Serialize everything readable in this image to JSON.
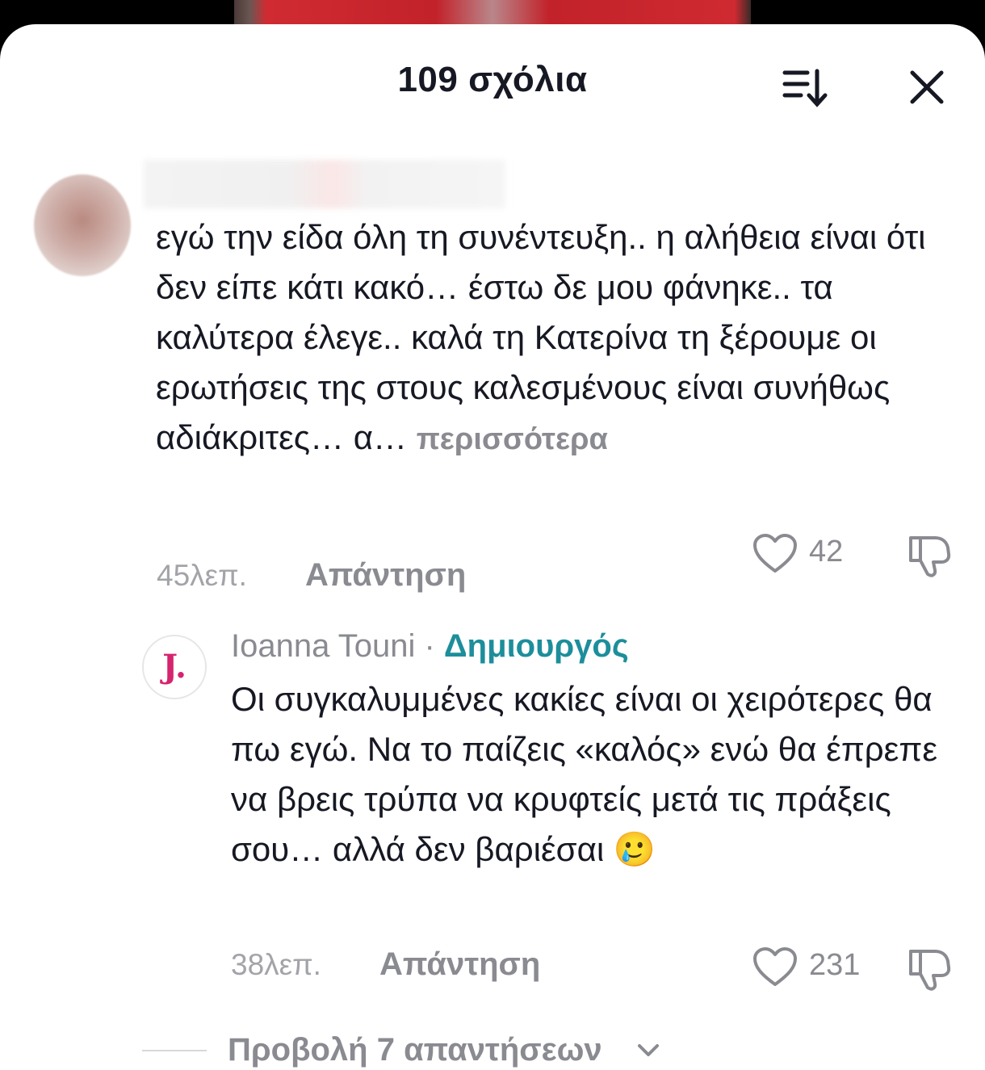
{
  "header": {
    "title": "109 σχόλια",
    "sort_icon": "sort-descending-icon",
    "close_icon": "close-icon"
  },
  "comments": [
    {
      "text": "εγώ την είδα όλη τη συνέντευξη.. η αλήθεια είναι ότι δεν είπε κάτι κακό… έστω δε μου φάνηκε.. τα καλύτερα έλεγε.. καλά τη Κατερίνα τη ξέρουμε οι ερωτήσεις της στους καλεσμένους είναι συνήθως αδιάκριτες… α…",
      "more_label": "περισσότερα",
      "time": "45λεπ.",
      "reply_label": "Απάντηση",
      "likes": "42"
    },
    {
      "author": "Ioanna Touni",
      "separator": " · ",
      "badge": "Δημιουργός",
      "avatar_letter": "J.",
      "text": "Οι συγκαλυμμένες κακίες είναι οι χειρότερες θα πω εγώ. Να το παίζεις «καλός» ενώ θα έπρεπε να βρεις τρύπα να κρυφτείς μετά τις πράξεις σου… αλλά δεν βαριέσαι 🥲",
      "time": "38λεπ.",
      "reply_label": "Απάντηση",
      "likes": "231"
    }
  ],
  "view_replies_label": "Προβολή 7 απαντήσεων",
  "colors": {
    "text": "#161823",
    "muted": "#8a8b91",
    "creator_badge": "#1d8e9b",
    "avatar_letter": "#d6246e"
  }
}
